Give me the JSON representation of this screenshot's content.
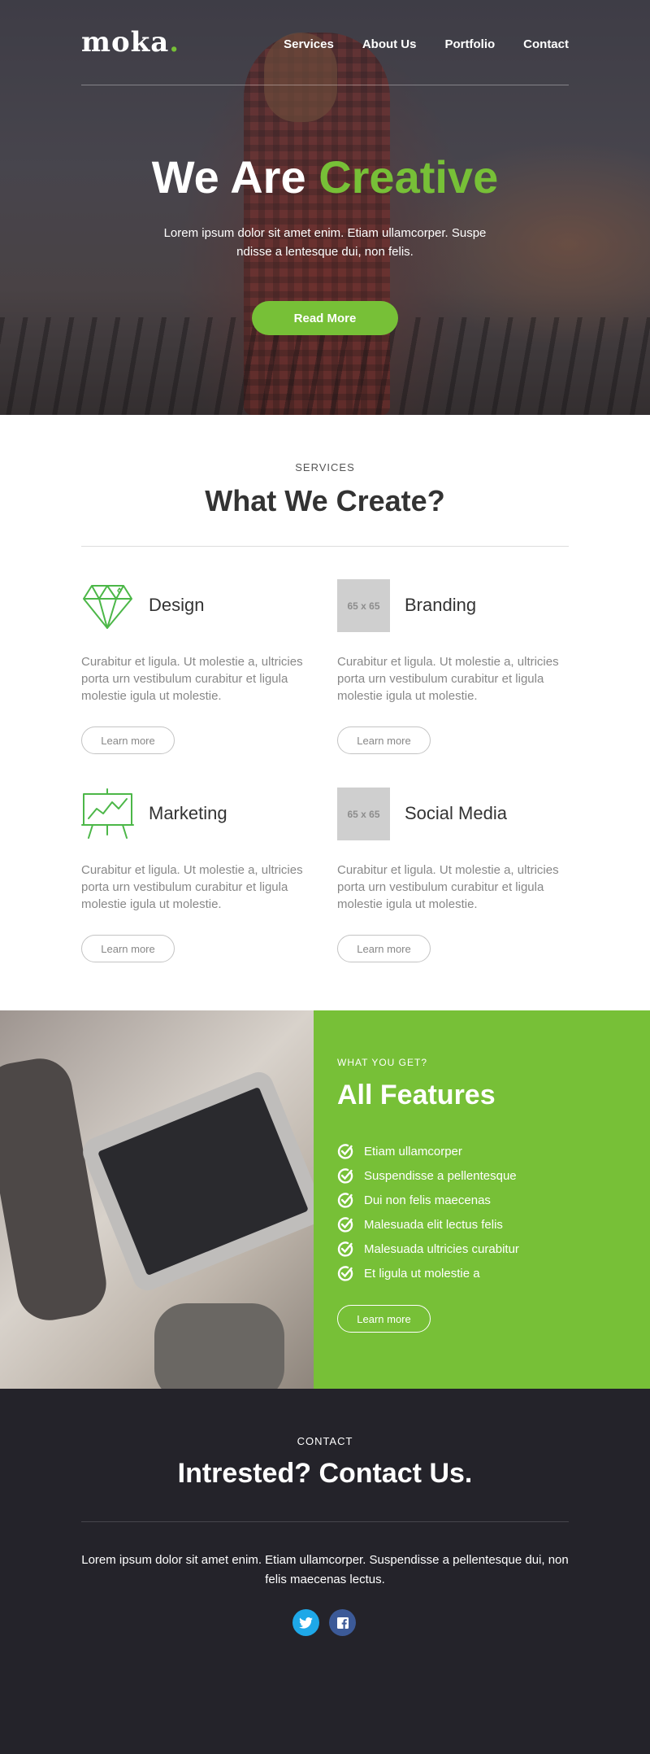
{
  "header": {
    "logo": "moka",
    "logo_dot": ".",
    "nav": [
      "Services",
      "About Us",
      "Portfolio",
      "Contact"
    ]
  },
  "hero": {
    "title_part1": "We Are",
    "title_accent": "Creative",
    "subtitle": "Lorem ipsum dolor sit amet enim. Etiam ullamcorper. Suspe ndisse a lentesque dui, non felis.",
    "button": "Read More"
  },
  "services": {
    "eyebrow": "SERVICES",
    "title": "What We Create?",
    "items": [
      {
        "title": "Design",
        "icon": "diamond-icon",
        "placeholder": "",
        "text": "Curabitur et ligula. Ut molestie a, ultricies porta urn vestibulum curabitur et ligula molestie igula ut molestie.",
        "button": "Learn more"
      },
      {
        "title": "Branding",
        "icon": "placeholder",
        "placeholder": "65 x 65",
        "text": "Curabitur et ligula. Ut molestie a, ultricies porta urn vestibulum curabitur et ligula molestie igula ut molestie.",
        "button": "Learn more"
      },
      {
        "title": "Marketing",
        "icon": "presentation-chart-icon",
        "placeholder": "",
        "text": "Curabitur et ligula. Ut molestie a, ultricies porta urn vestibulum curabitur et ligula molestie igula ut molestie.",
        "button": "Learn more"
      },
      {
        "title": "Social Media",
        "icon": "placeholder",
        "placeholder": "65 x 65",
        "text": "Curabitur et ligula. Ut molestie a, ultricies porta urn vestibulum curabitur et ligula molestie igula ut molestie.",
        "button": "Learn more"
      }
    ]
  },
  "features": {
    "eyebrow": "WHAT YOU GET?",
    "title": "All Features",
    "items": [
      "Etiam ullamcorper",
      "Suspendisse a pellentesque",
      "Dui non felis maecenas",
      "Malesuada elit lectus felis",
      "Malesuada ultricies curabitur",
      "Et ligula ut molestie a"
    ],
    "button": "Learn more"
  },
  "contact": {
    "eyebrow": "CONTACT",
    "title": "Intrested? Contact Us.",
    "text": "Lorem ipsum dolor sit amet enim. Etiam ullamcorper. Suspendisse a pellentesque dui, non felis maecenas lectus.",
    "socials": [
      "twitter-icon",
      "facebook-icon"
    ]
  },
  "colors": {
    "accent": "#77c037",
    "dark": "#24232a",
    "twitter": "#1ea8e8",
    "facebook": "#3c5a98"
  }
}
